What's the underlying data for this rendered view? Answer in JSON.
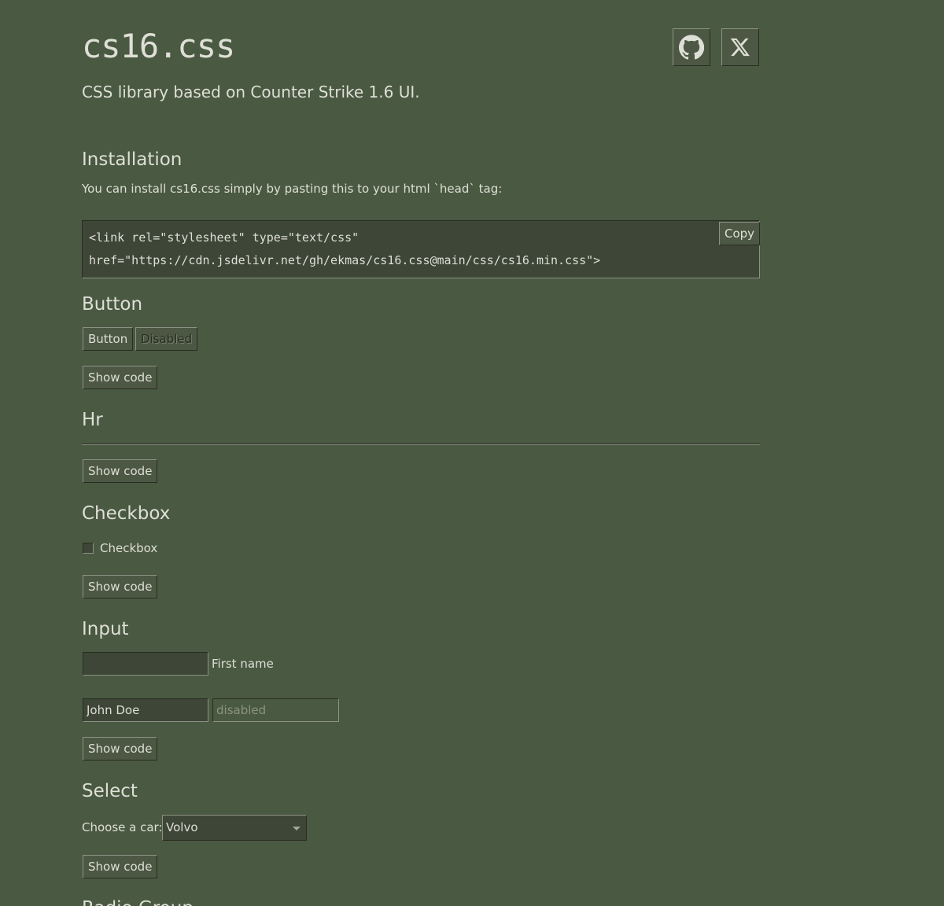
{
  "header": {
    "title": "cs16.css",
    "subtitle": "CSS library based on Counter Strike 1.6 UI.",
    "github_icon": "github-icon",
    "x_icon": "x-logo-icon"
  },
  "installation": {
    "heading": "Installation",
    "description": "You can install cs16.css simply by pasting this to your html `head` tag:",
    "code_line_1": "<link rel=\"stylesheet\" type=\"text/css\"",
    "code_line_2": "href=\"https://cdn.jsdelivr.net/gh/ekmas/cs16.css@main/css/cs16.min.css\">",
    "copy_label": "Copy"
  },
  "button_section": {
    "heading": "Button",
    "button_label": "Button",
    "disabled_label": "Disabled",
    "show_code": "Show code"
  },
  "hr_section": {
    "heading": "Hr",
    "show_code": "Show code"
  },
  "checkbox_section": {
    "heading": "Checkbox",
    "label": "Checkbox",
    "show_code": "Show code"
  },
  "input_section": {
    "heading": "Input",
    "first_name_value": "",
    "first_name_label": "First name",
    "filled_value": "John Doe",
    "disabled_placeholder": "disabled",
    "show_code": "Show code"
  },
  "select_section": {
    "heading": "Select",
    "label": "Choose a car:",
    "selected": "Volvo",
    "show_code": "Show code"
  },
  "next_section": {
    "heading": "Radio Group"
  },
  "colors": {
    "background": "#4a5942",
    "text": "#dedfd6",
    "input_bg": "#3e4637",
    "border_light": "#8c9284",
    "border_dark": "#292c21"
  }
}
